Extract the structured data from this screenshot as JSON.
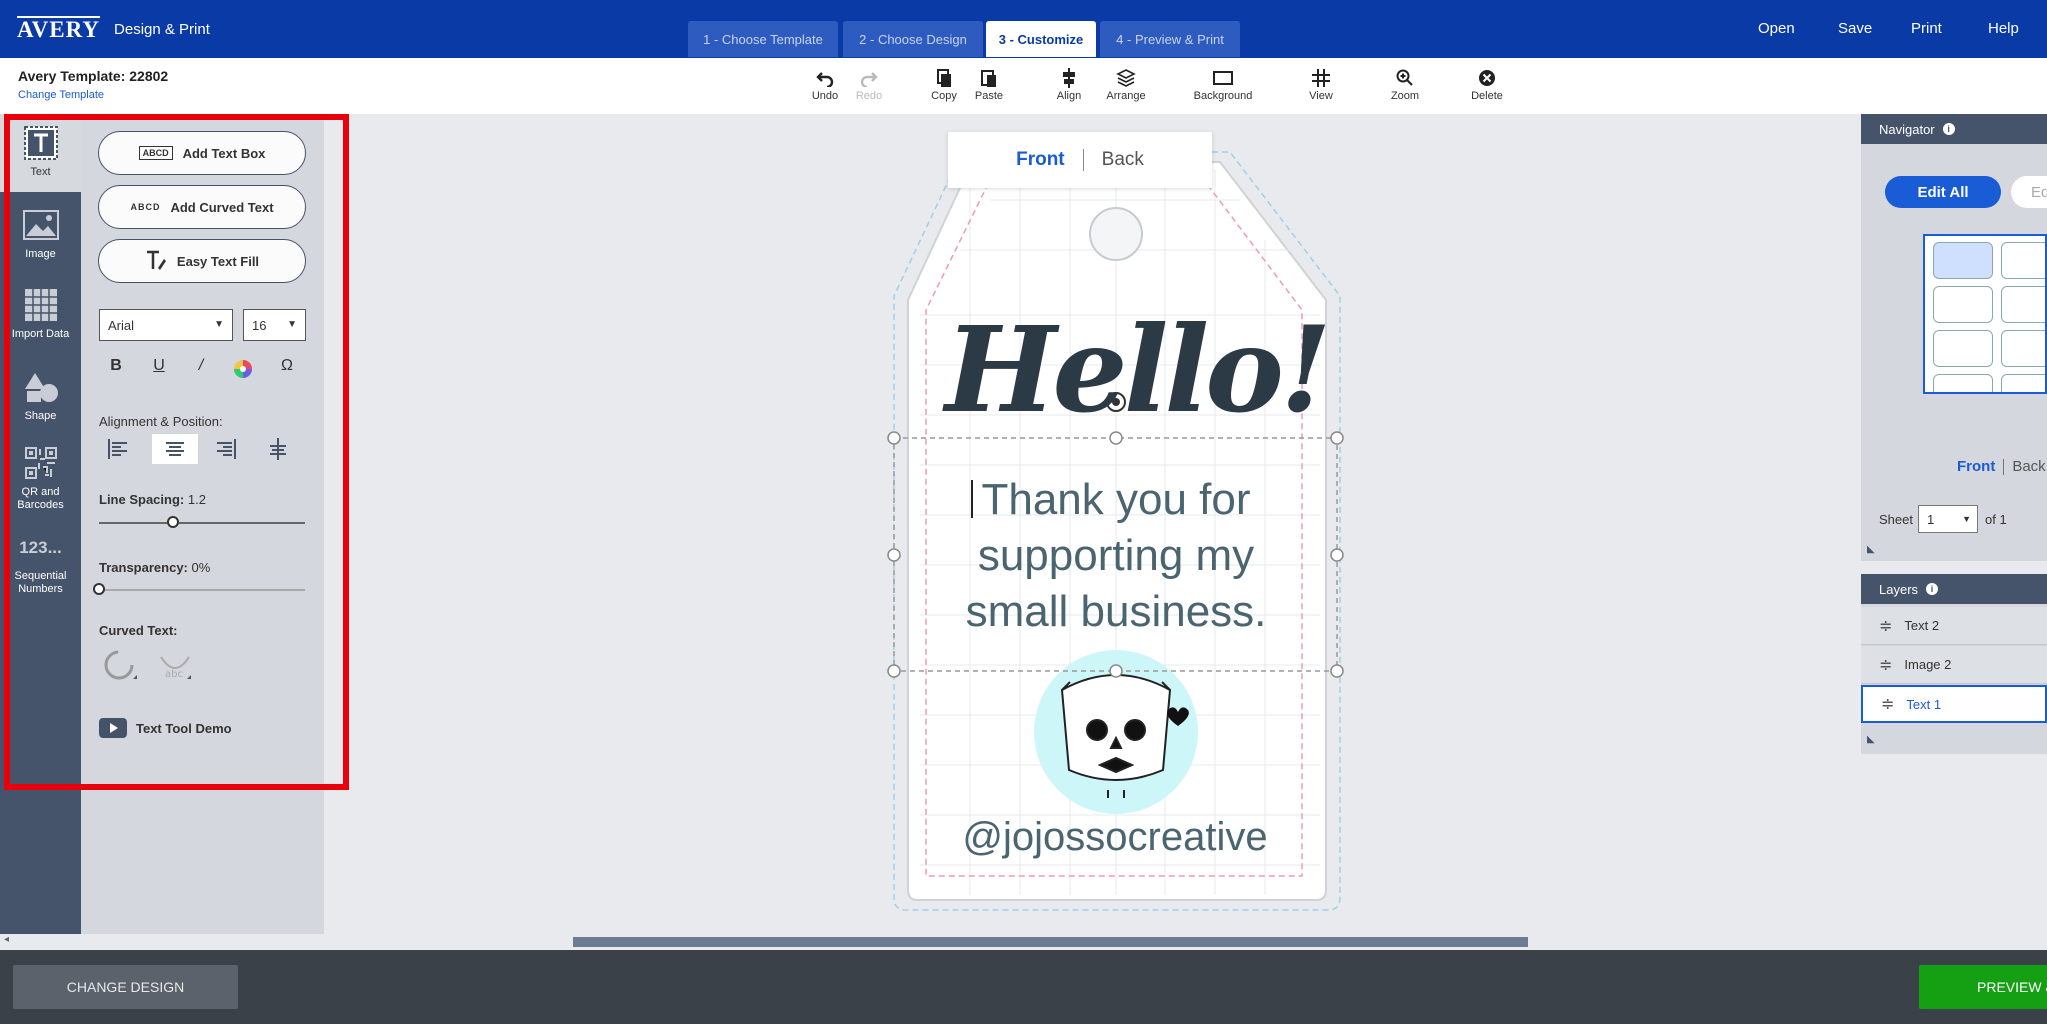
{
  "header": {
    "brand": "AVERY",
    "app_name": "Design & Print",
    "steps": [
      "1 - Choose Template",
      "2 - Choose Design",
      "3 - Customize",
      "4 - Preview & Print"
    ],
    "active_step": 2,
    "nav": [
      "Open",
      "Save",
      "Print",
      "Help"
    ]
  },
  "toolbar": {
    "template_title": "Avery Template: 22802",
    "change_template": "Change Template",
    "tools": [
      {
        "label": "Undo",
        "icon": "undo-icon",
        "enabled": true
      },
      {
        "label": "Redo",
        "icon": "redo-icon",
        "enabled": false
      },
      {
        "label": "Copy",
        "icon": "copy-icon",
        "enabled": true
      },
      {
        "label": "Paste",
        "icon": "paste-icon",
        "enabled": true
      },
      {
        "label": "Align",
        "icon": "align-icon",
        "enabled": true
      },
      {
        "label": "Arrange",
        "icon": "layers-icon",
        "enabled": true
      },
      {
        "label": "Background",
        "icon": "background-icon",
        "enabled": true
      },
      {
        "label": "View",
        "icon": "grid-icon",
        "enabled": true
      },
      {
        "label": "Zoom",
        "icon": "zoom-icon",
        "enabled": true
      },
      {
        "label": "Delete",
        "icon": "delete-icon",
        "enabled": true
      }
    ]
  },
  "left_rail": {
    "items": [
      {
        "label": "Text",
        "icon": "text-icon"
      },
      {
        "label": "Image",
        "icon": "image-icon"
      },
      {
        "label": "Import Data",
        "icon": "table-icon"
      },
      {
        "label": "Shape",
        "icon": "shape-icon"
      },
      {
        "label": "QR and Barcodes",
        "icon": "qr-code-icon"
      },
      {
        "label": "Sequential Numbers",
        "icon": "sequential-numbers-icon",
        "glyph": "123..."
      }
    ],
    "active": 0
  },
  "text_panel": {
    "add_text_box": "Add Text Box",
    "add_text_box_icon_text": "ABCD",
    "add_curved_text": "Add Curved Text",
    "add_curved_text_icon_text": "ABCD",
    "easy_text_fill": "Easy Text Fill",
    "font": "Arial",
    "size": "16",
    "alignment_label": "Alignment & Position:",
    "line_spacing_label": "Line Spacing:",
    "line_spacing_value": "1.2",
    "line_spacing_fraction": 0.36,
    "transparency_label": "Transparency:",
    "transparency_value": "0%",
    "transparency_fraction": 0.0,
    "curved_text_label": "Curved Text:",
    "demo_label": "Text Tool Demo"
  },
  "canvas": {
    "front_label": "Front",
    "back_label": "Back",
    "hello": "Hello!",
    "body_lines": [
      "Thank you for",
      "supporting my",
      "small business."
    ],
    "handle": "@jojossocreative"
  },
  "navigator": {
    "title": "Navigator",
    "edit_all": "Edit All",
    "edit_partial": "Ed",
    "front": "Front",
    "back": "Back",
    "sheet_label": "Sheet",
    "sheet_value": "1",
    "of_label": "of 1"
  },
  "layers": {
    "title": "Layers",
    "items": [
      "Text 2",
      "Image 2",
      "Text 1"
    ],
    "active": 2
  },
  "footer": {
    "change_design": "CHANGE DESIGN",
    "preview": "PREVIEW & PRINT"
  },
  "colors": {
    "brand_blue": "#0a3aa6",
    "accent_blue": "#1a5bd6",
    "rail": "#46546b",
    "panel": "#d4d7dd",
    "highlight": "#e8000a",
    "preview_green": "#15a013"
  }
}
